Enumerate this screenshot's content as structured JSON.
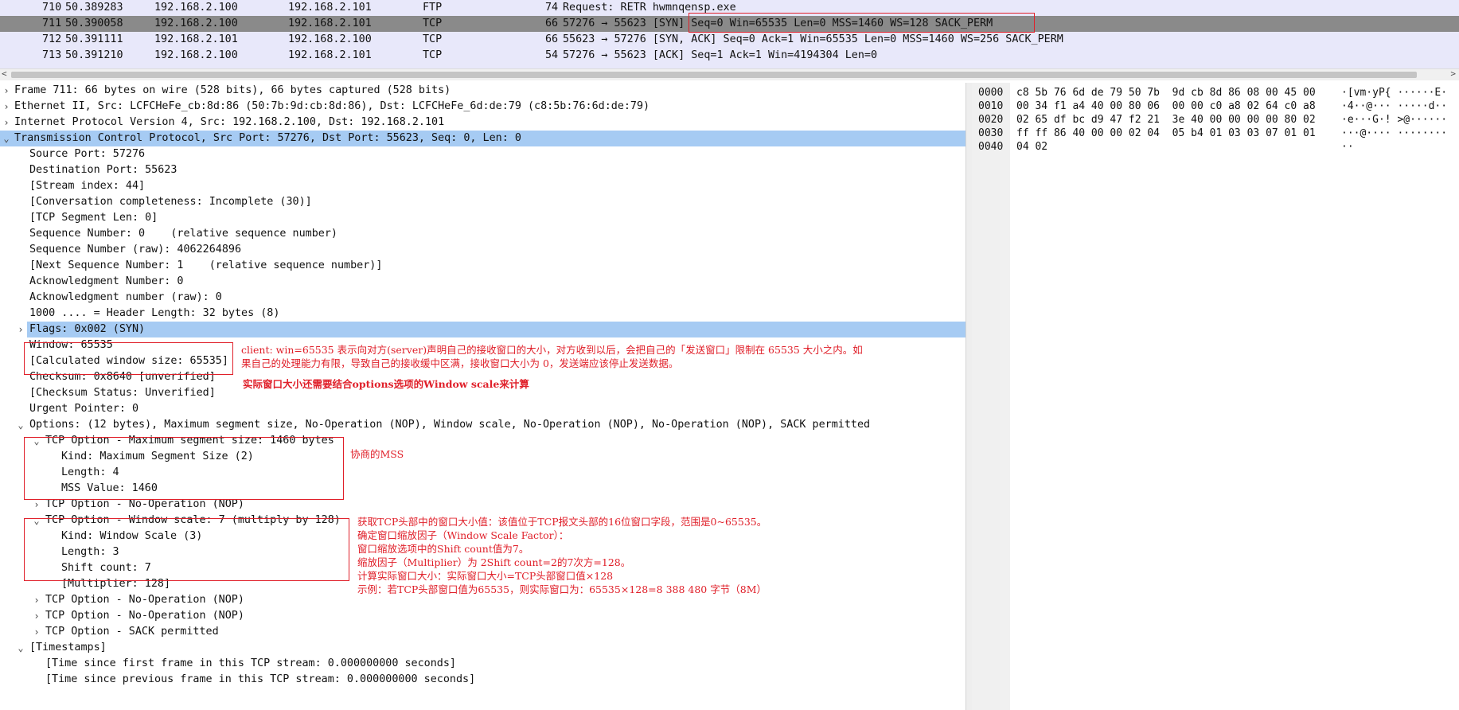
{
  "packet_list": {
    "rows": [
      {
        "no": "710",
        "time": "50.389283",
        "src": "192.168.2.100",
        "dst": "192.168.2.101",
        "proto": "FTP",
        "len": "74",
        "info": "Request: RETR hwmnqensp.exe",
        "selected": false
      },
      {
        "no": "711",
        "time": "50.390058",
        "src": "192.168.2.100",
        "dst": "192.168.2.101",
        "proto": "TCP",
        "len": "66",
        "info": "57276 → 55623 [SYN] Seq=0 Win=65535 Len=0 MSS=1460 WS=128 SACK_PERM",
        "selected": true
      },
      {
        "no": "712",
        "time": "50.391111",
        "src": "192.168.2.101",
        "dst": "192.168.2.100",
        "proto": "TCP",
        "len": "66",
        "info": "55623 → 57276 [SYN, ACK] Seq=0 Ack=1 Win=65535 Len=0 MSS=1460 WS=256 SACK_PERM",
        "selected": false
      },
      {
        "no": "713",
        "time": "50.391210",
        "src": "192.168.2.100",
        "dst": "192.168.2.101",
        "proto": "TCP",
        "len": "54",
        "info": "57276 → 55623 [ACK] Seq=1 Ack=1 Win=4194304 Len=0",
        "selected": false
      }
    ]
  },
  "details": {
    "rows": [
      {
        "caret": "›",
        "indent": 0,
        "text": "Frame 711: 66 bytes on wire (528 bits), 66 bytes captured (528 bits)",
        "hl": false
      },
      {
        "caret": "›",
        "indent": 0,
        "text": "Ethernet II, Src: LCFCHeFe_cb:8d:86 (50:7b:9d:cb:8d:86), Dst: LCFCHeFe_6d:de:79 (c8:5b:76:6d:de:79)",
        "hl": false
      },
      {
        "caret": "›",
        "indent": 0,
        "text": "Internet Protocol Version 4, Src: 192.168.2.100, Dst: 192.168.2.101",
        "hl": false
      },
      {
        "caret": "⌄",
        "indent": 0,
        "text": "Transmission Control Protocol, Src Port: 57276, Dst Port: 55623, Seq: 0, Len: 0",
        "hl": true
      },
      {
        "caret": "",
        "indent": 1,
        "text": "Source Port: 57276",
        "hl": false
      },
      {
        "caret": "",
        "indent": 1,
        "text": "Destination Port: 55623",
        "hl": false
      },
      {
        "caret": "",
        "indent": 1,
        "text": "[Stream index: 44]",
        "hl": false
      },
      {
        "caret": "",
        "indent": 1,
        "text": "[Conversation completeness: Incomplete (30)]",
        "hl": false
      },
      {
        "caret": "",
        "indent": 1,
        "text": "[TCP Segment Len: 0]",
        "hl": false
      },
      {
        "caret": "",
        "indent": 1,
        "text": "Sequence Number: 0    (relative sequence number)",
        "hl": false
      },
      {
        "caret": "",
        "indent": 1,
        "text": "Sequence Number (raw): 4062264896",
        "hl": false
      },
      {
        "caret": "",
        "indent": 1,
        "text": "[Next Sequence Number: 1    (relative sequence number)]",
        "hl": false
      },
      {
        "caret": "",
        "indent": 1,
        "text": "Acknowledgment Number: 0",
        "hl": false
      },
      {
        "caret": "",
        "indent": 1,
        "text": "Acknowledgment number (raw): 0",
        "hl": false
      },
      {
        "caret": "",
        "indent": 1,
        "text": "1000 .... = Header Length: 32 bytes (8)",
        "hl": false
      },
      {
        "caret": "›",
        "indent": 1,
        "text": "Flags: 0x002 (SYN)",
        "hl": true
      },
      {
        "caret": "",
        "indent": 1,
        "text": "Window: 65535",
        "hl": false
      },
      {
        "caret": "",
        "indent": 1,
        "text": "[Calculated window size: 65535]",
        "hl": false
      },
      {
        "caret": "",
        "indent": 1,
        "text": "Checksum: 0x8640 [unverified]",
        "hl": false
      },
      {
        "caret": "",
        "indent": 1,
        "text": "[Checksum Status: Unverified]",
        "hl": false
      },
      {
        "caret": "",
        "indent": 1,
        "text": "Urgent Pointer: 0",
        "hl": false
      },
      {
        "caret": "⌄",
        "indent": 1,
        "text": "Options: (12 bytes), Maximum segment size, No-Operation (NOP), Window scale, No-Operation (NOP), No-Operation (NOP), SACK permitted",
        "hl": false
      },
      {
        "caret": "⌄",
        "indent": 2,
        "text": "TCP Option - Maximum segment size: 1460 bytes",
        "hl": false
      },
      {
        "caret": "",
        "indent": 3,
        "text": "Kind: Maximum Segment Size (2)",
        "hl": false
      },
      {
        "caret": "",
        "indent": 3,
        "text": "Length: 4",
        "hl": false
      },
      {
        "caret": "",
        "indent": 3,
        "text": "MSS Value: 1460",
        "hl": false
      },
      {
        "caret": "›",
        "indent": 2,
        "text": "TCP Option - No-Operation (NOP)",
        "hl": false
      },
      {
        "caret": "⌄",
        "indent": 2,
        "text": "TCP Option - Window scale: 7 (multiply by 128)",
        "hl": false
      },
      {
        "caret": "",
        "indent": 3,
        "text": "Kind: Window Scale (3)",
        "hl": false
      },
      {
        "caret": "",
        "indent": 3,
        "text": "Length: 3",
        "hl": false
      },
      {
        "caret": "",
        "indent": 3,
        "text": "Shift count: 7",
        "hl": false
      },
      {
        "caret": "",
        "indent": 3,
        "text": "[Multiplier: 128]",
        "hl": false
      },
      {
        "caret": "›",
        "indent": 2,
        "text": "TCP Option - No-Operation (NOP)",
        "hl": false
      },
      {
        "caret": "›",
        "indent": 2,
        "text": "TCP Option - No-Operation (NOP)",
        "hl": false
      },
      {
        "caret": "›",
        "indent": 2,
        "text": "TCP Option - SACK permitted",
        "hl": false
      },
      {
        "caret": "⌄",
        "indent": 1,
        "text": "[Timestamps]",
        "hl": false
      },
      {
        "caret": "",
        "indent": 2,
        "text": "[Time since first frame in this TCP stream: 0.000000000 seconds]",
        "hl": false
      },
      {
        "caret": "",
        "indent": 2,
        "text": "[Time since previous frame in this TCP stream: 0.000000000 seconds]",
        "hl": false
      }
    ]
  },
  "hex": {
    "rows": [
      {
        "offset": "0000",
        "bytes": "c8 5b 76 6d de 79 50 7b  9d cb 8d 86 08 00 45 00",
        "ascii": "·[vm·yP{ ······E·"
      },
      {
        "offset": "0010",
        "bytes": "00 34 f1 a4 40 00 80 06  00 00 c0 a8 02 64 c0 a8",
        "ascii": "·4··@··· ·····d··"
      },
      {
        "offset": "0020",
        "bytes": "02 65 df bc d9 47 f2 21  3e 40 00 00 00 00 80 02",
        "ascii": "·e···G·! >@······"
      },
      {
        "offset": "0030",
        "bytes": "ff ff 86 40 00 00 02 04  05 b4 01 03 03 07 01 01",
        "ascii": "···@···· ········"
      },
      {
        "offset": "0040",
        "bytes": "04 02",
        "ascii": "··"
      }
    ]
  },
  "annotations": {
    "window_note_line1": "client: win=65535 表示向对方(server)声明自己的接收窗口的大小，对方收到以后，会把自己的「发送窗口」限制在 65535 大小之内。如",
    "window_note_line2": "果自己的处理能力有限，导致自己的接收缓中区满，接收窗口大小为 0，发送端应该停止发送数据。",
    "window_scale_hint": "实际窗口大小还需要结合options选项的Window scale来计算",
    "mss_note": "协商的MSS",
    "ws_notes": [
      "获取TCP头部中的窗口大小值：该值位于TCP报文头部的16位窗口字段，范围是0~65535。",
      "确定窗口缩放因子（Window Scale Factor）：",
      "窗口缩放选项中的Shift count值为7。",
      "缩放因子（Multiplier）为 2Shift count=2的7次方=128。",
      "计算实际窗口大小：实际窗口大小=TCP头部窗口值×128",
      "示例：若TCP头部窗口值为65535，则实际窗口为：65535×128=8 388 480 字节（8M）"
    ],
    "color": "#e0202a"
  },
  "colors": {
    "packet_bg": "#e8e8fa",
    "selected_row": "#8a8a8a",
    "highlight": "#a6cbf3"
  }
}
